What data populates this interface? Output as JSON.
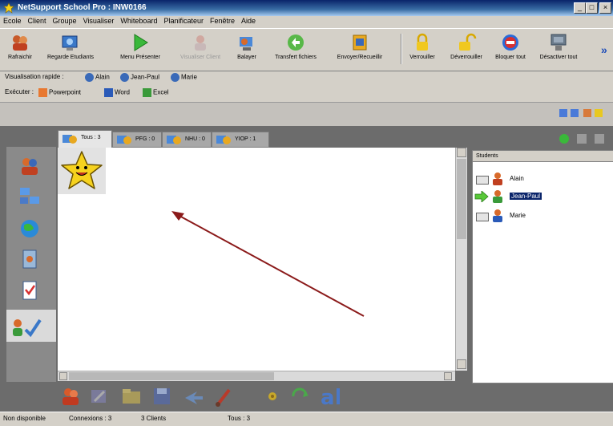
{
  "window": {
    "title": "NetSupport School Pro : INW0166"
  },
  "window_buttons": [
    "_",
    "□",
    "×"
  ],
  "menu": [
    "Ecole",
    "Client",
    "Groupe",
    "Visualiser",
    "Whiteboard",
    "Planificateur",
    "Fenêtre",
    "Aide"
  ],
  "toolbar": [
    {
      "label": "Rafraichir",
      "icon": "refresh-icon",
      "dim": false
    },
    {
      "label": "Regarde Etudiants",
      "icon": "watch-students-icon",
      "dim": false
    },
    {
      "label": "Menu Présenter",
      "icon": "present-icon",
      "dim": false
    },
    {
      "label": "Visualiser Client",
      "icon": "view-client-icon",
      "dim": true
    },
    {
      "label": "Balayer",
      "icon": "scan-icon",
      "dim": false
    },
    {
      "label": "Transfert fichiers",
      "icon": "file-transfer-icon",
      "dim": false
    },
    {
      "label": "Envoyer/Recueillir",
      "icon": "send-collect-icon",
      "dim": false
    },
    {
      "label": "Verrouiller",
      "icon": "lock-icon",
      "dim": false
    },
    {
      "label": "Déverrouiller",
      "icon": "unlock-icon",
      "dim": false
    },
    {
      "label": "Bloquer tout",
      "icon": "block-all-icon",
      "dim": false
    },
    {
      "label": "Désactiver tout",
      "icon": "disable-all-icon",
      "dim": false
    }
  ],
  "quickview": {
    "label": "Visualisation rapide :",
    "items": [
      "Alain",
      "Jean-Paul",
      "Marie"
    ]
  },
  "execute": {
    "label": "Exécuter :",
    "items": [
      "Powerpoint",
      "Word",
      "Excel"
    ]
  },
  "tabs": [
    {
      "label": "Tous : 3",
      "active": true
    },
    {
      "label": "PFG : 0",
      "active": false
    },
    {
      "label": "NHU : 0",
      "active": false
    },
    {
      "label": "YIOP : 1",
      "active": false
    }
  ],
  "students": {
    "header": "Students",
    "rows": [
      {
        "name": "Alain",
        "selected": false,
        "status": "laptop"
      },
      {
        "name": "Jean-Paul",
        "selected": true,
        "status": "arrow"
      },
      {
        "name": "Marie",
        "selected": false,
        "status": "laptop"
      }
    ]
  },
  "status": {
    "state": "Non disponible",
    "connections": "Connexions : 3",
    "clients": "3 Clients",
    "total": "Tous : 3"
  },
  "colors": {
    "titlebar": "#0a246a",
    "selection": "#0a246a",
    "arrow": "#8b1a1a",
    "star": "#f6d21e"
  }
}
